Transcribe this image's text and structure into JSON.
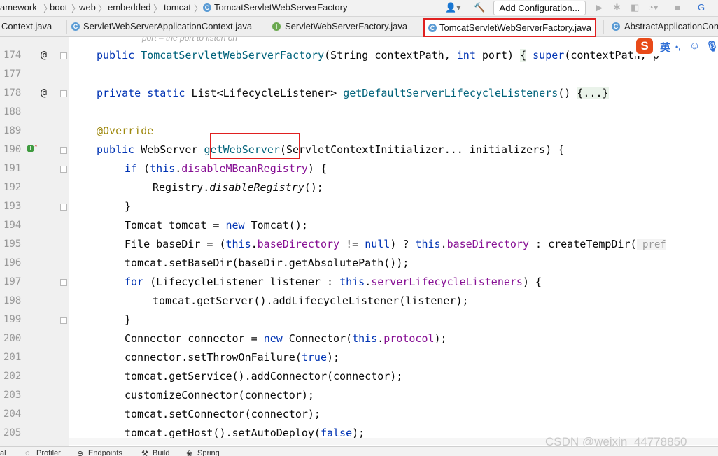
{
  "breadcrumb": [
    "amework",
    "boot",
    "web",
    "embedded",
    "tomcat",
    "TomcatServletWebServerFactory"
  ],
  "toolbar": {
    "add_configuration": "Add Configuration..."
  },
  "tabs": [
    {
      "label": "Context.java",
      "icon": "class-icon"
    },
    {
      "label": "ServletWebServerApplicationContext.java",
      "icon": "class-icon"
    },
    {
      "label": "ServletWebServerFactory.java",
      "icon": "interface-icon"
    },
    {
      "label": "TomcatServletWebServerFactory.java",
      "icon": "class-icon",
      "active": true
    },
    {
      "label": "AbstractApplicationCon",
      "icon": "class-icon"
    }
  ],
  "editor": {
    "doc_ghost": "port – the port to listen on",
    "line_numbers": [
      "174",
      "177",
      "178",
      "188",
      "189",
      "190",
      "191",
      "192",
      "193",
      "194",
      "195",
      "196",
      "197",
      "198",
      "199",
      "200",
      "201",
      "202",
      "203",
      "204",
      "205"
    ],
    "lines": {
      "l174": {
        "kw1": "public ",
        "fn": "TomcatServletWebServerFactory",
        "t1": "(String contextPath, ",
        "kw2": "int",
        "t2": " port) ",
        "fold": "{",
        "kw3": " super",
        "t3": "(contextPath, p"
      },
      "l178": {
        "kw1": "private static ",
        "t1": "List<LifecycleListener> ",
        "fn": "getDefaultServerLifecycleListeners",
        "t2": "() ",
        "fold": "{...}"
      },
      "l189": {
        "an": "@Override"
      },
      "l190": {
        "kw1": "public ",
        "t1": "WebServer ",
        "fn": "getWebServer",
        "t2": "(ServletContextInitializer... initializers) {"
      },
      "l191": {
        "kw1": "if ",
        "t1": "(",
        "kw2": "this",
        "t2": ".",
        "fd": "disableMBeanRegistry",
        "t3": ") {"
      },
      "l192": {
        "t1": "Registry.",
        "it": "disableRegistry",
        "t2": "();"
      },
      "l193": {
        "t1": "}"
      },
      "l194": {
        "t1": "Tomcat tomcat = ",
        "kw1": "new",
        "t2": " Tomcat();"
      },
      "l195": {
        "t1": "File baseDir = (",
        "kw1": "this",
        "t2": ".",
        "fd1": "baseDirectory",
        "t3": " != ",
        "kw2": "null",
        "t4": ") ? ",
        "kw3": "this",
        "t5": ".",
        "fd2": "baseDirectory",
        "t6": " : createTempDir(",
        "hint": " pref"
      },
      "l196": {
        "t1": "tomcat.setBaseDir(baseDir.getAbsolutePath());"
      },
      "l197": {
        "kw1": "for ",
        "t1": "(LifecycleListener listener : ",
        "kw2": "this",
        "t2": ".",
        "fd": "serverLifecycleListeners",
        "t3": ") {"
      },
      "l198": {
        "t1": "tomcat.getServer().addLifecycleListener(listener);"
      },
      "l199": {
        "t1": "}"
      },
      "l200": {
        "t1": "Connector connector = ",
        "kw1": "new",
        "t2": " Connector(",
        "kw2": "this",
        "t3": ".",
        "fd": "protocol",
        "t4": ");"
      },
      "l201": {
        "t1": "connector.setThrowOnFailure(",
        "kw1": "true",
        "t2": ");"
      },
      "l202": {
        "t1": "tomcat.getService().addConnector(connector);"
      },
      "l203": {
        "t1": "customizeConnector(connector);"
      },
      "l204": {
        "t1": "tomcat.setConnector(connector);"
      },
      "l205": {
        "t1": "tomcat.getHost().setAutoDeploy(",
        "kw1": "false",
        "t2": ");"
      }
    }
  },
  "ime": {
    "lang": "英",
    "punct": "•,",
    "emoji": "☺"
  },
  "bottom_tools": [
    "al",
    "Profiler",
    "Endpoints",
    "Build",
    "Spring"
  ],
  "watermark": "CSDN @weixin_44778850",
  "colors": {
    "keyword": "#0033b3",
    "method": "#00627a",
    "field": "#871094",
    "annotation": "#9e880d",
    "highlight_box": "#e02020"
  }
}
